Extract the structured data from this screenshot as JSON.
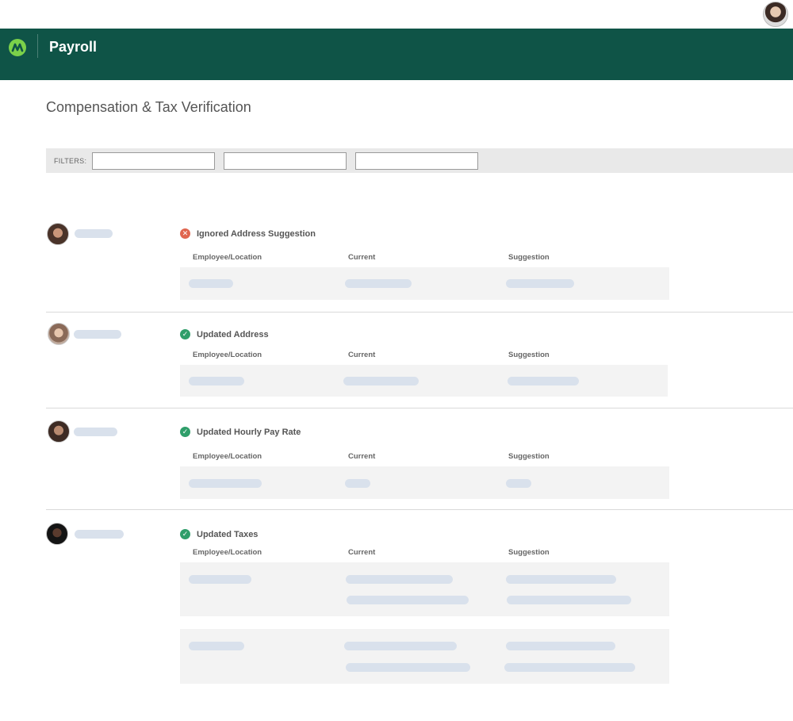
{
  "app": {
    "title": "Payroll"
  },
  "page": {
    "title": "Compensation & Tax Verification"
  },
  "filters": {
    "label": "FILTERS:",
    "inputs": [
      {
        "value": "",
        "placeholder": ""
      },
      {
        "value": "",
        "placeholder": ""
      },
      {
        "value": "",
        "placeholder": ""
      }
    ]
  },
  "columns": {
    "employee": "Employee/Location",
    "current": "Current",
    "suggestion": "Suggestion"
  },
  "records": [
    {
      "status": "error",
      "title": "Ignored Address Suggestion"
    },
    {
      "status": "ok",
      "title": "Updated Address"
    },
    {
      "status": "ok",
      "title": "Updated Hourly Pay Rate"
    },
    {
      "status": "ok",
      "title": "Updated Taxes"
    }
  ],
  "icons": {
    "logo": "payroll-logo-icon",
    "ok": "check-circle-icon",
    "error": "x-circle-icon"
  },
  "colors": {
    "header": "#0f5447",
    "logo_accent": "#7bd14a",
    "ok": "#2f9e6a",
    "error": "#e0664f",
    "placeholder_pill": "#d9e1ec"
  }
}
